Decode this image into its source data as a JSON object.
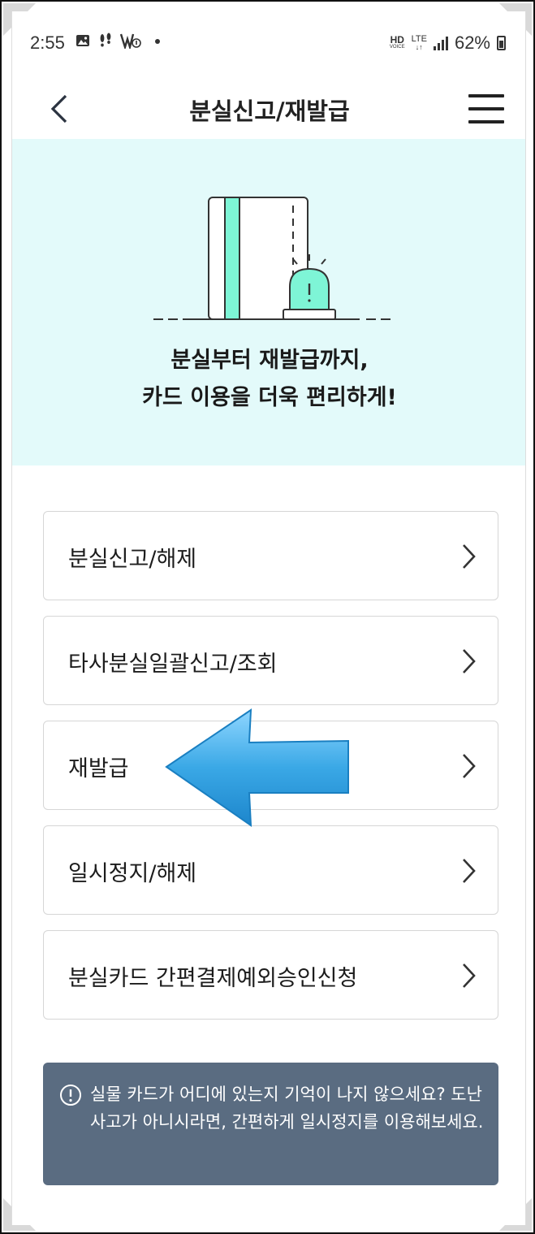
{
  "status_bar": {
    "time": "2:55",
    "notification_icons": [
      "image-icon",
      "footprints-icon",
      "vibrate-icon"
    ],
    "hd_label": "HD",
    "voice_label": "VOICE",
    "network_label": "LTE",
    "battery": "62%"
  },
  "header": {
    "title": "분실신고/재발급"
  },
  "banner": {
    "line1": "분실부터 재발급까지,",
    "line2": "카드 이용을 더욱 편리하게!",
    "colors": {
      "background": "#e3fafa",
      "card_stripe": "#7ef5d6",
      "siren": "#7ef5d6"
    }
  },
  "menu": {
    "items": [
      {
        "label": "분실신고/해제"
      },
      {
        "label": "타사분실일괄신고/조회"
      },
      {
        "label": "재발급"
      },
      {
        "label": "일시정지/해제"
      },
      {
        "label": "분실카드 간편결제예외승인신청"
      }
    ]
  },
  "notice": {
    "text": "실물 카드가 어디에 있는지 기억이 나지 않으세요? 도난 사고가 아니시라면, 간편하게 일시정지를 이용해보세요.",
    "background": "#5a6c81"
  },
  "annotation": {
    "arrow_color": "#3aa8e6"
  }
}
